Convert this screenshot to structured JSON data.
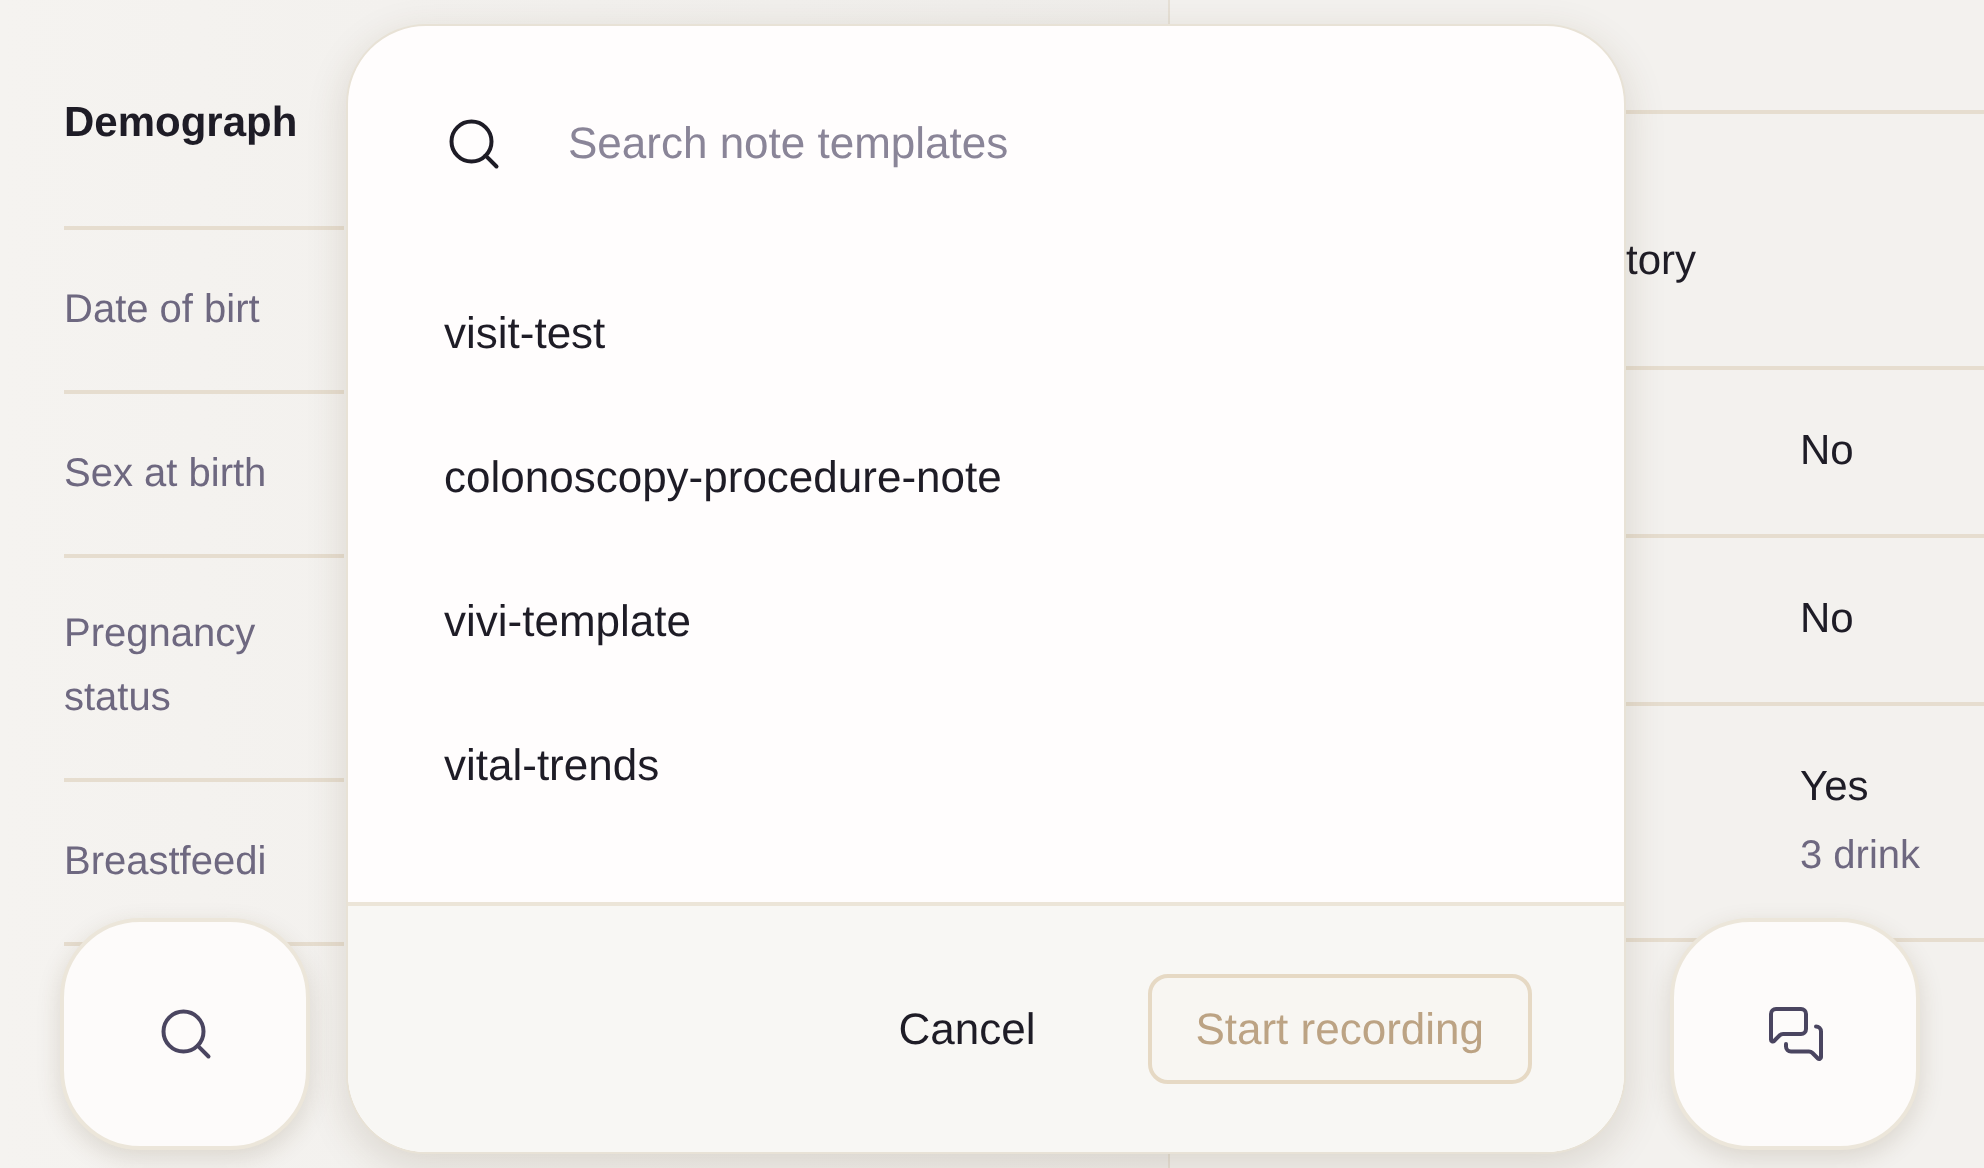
{
  "background": {
    "left_section": {
      "title": "Demograph",
      "rows": [
        {
          "label": "Date of birt"
        },
        {
          "label": "Sex at birth"
        },
        {
          "label": "Pregnancy status"
        },
        {
          "label": "Breastfeedi"
        }
      ]
    },
    "right_section": {
      "title": "tory",
      "rows": [
        {
          "value": "No"
        },
        {
          "value": "No"
        },
        {
          "value": "Yes",
          "detail": "3 drink"
        }
      ]
    }
  },
  "dialog": {
    "search": {
      "placeholder": "Search note templates"
    },
    "templates": [
      "visit-test",
      "colonoscopy-procedure-note",
      "vivi-template",
      "vital-trends"
    ],
    "cancel": "Cancel",
    "start": {
      "label": "Start recording",
      "disabled": true
    }
  }
}
